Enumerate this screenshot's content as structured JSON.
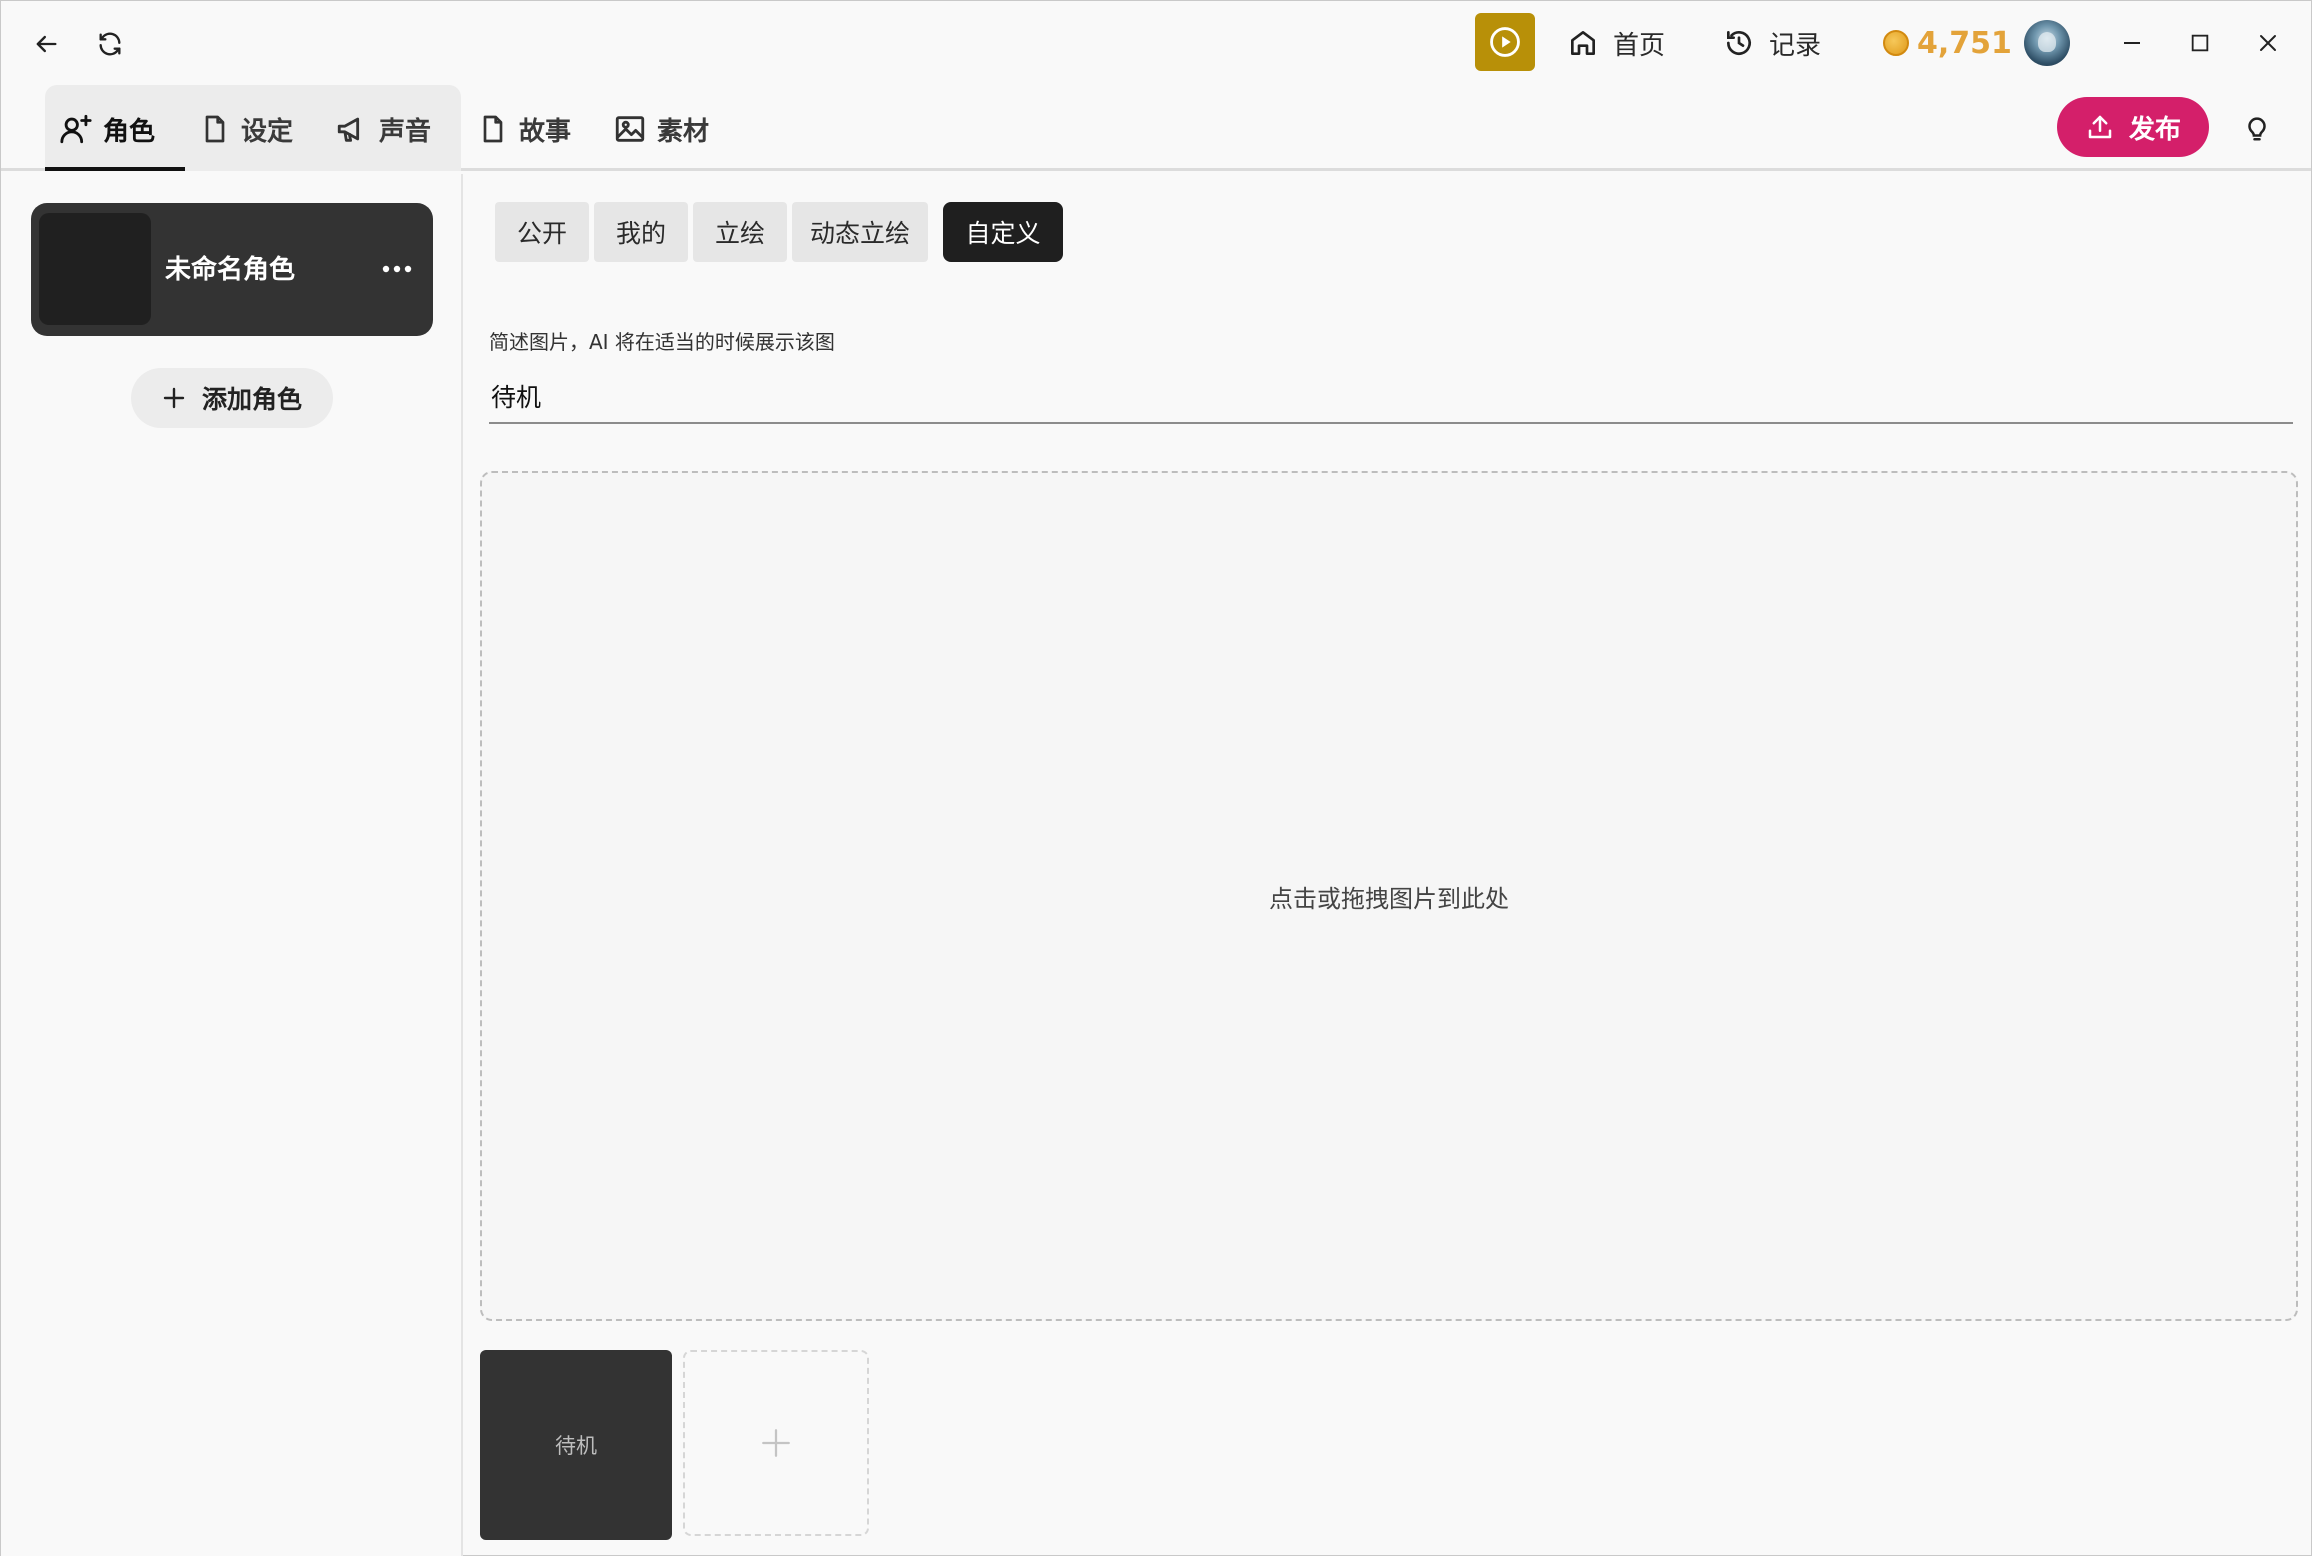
{
  "titlebar": {
    "nav_home_label": "首页",
    "nav_history_label": "记录",
    "coin_balance": "4,751",
    "icons": {
      "back": "arrow-left-icon",
      "reload": "refresh-icon",
      "play": "play-circle-icon",
      "home": "home-icon",
      "history": "history-icon",
      "minimize": "minimize-icon",
      "maximize": "maximize-icon",
      "close": "close-icon"
    },
    "colors": {
      "play_button": "#b89008",
      "coin": "#e3a33a"
    }
  },
  "tabs": {
    "items": [
      {
        "label": "角色",
        "icon": "user-plus-icon",
        "active": true
      },
      {
        "label": "设定",
        "icon": "document-icon",
        "active": false
      },
      {
        "label": "声音",
        "icon": "megaphone-icon",
        "active": false
      },
      {
        "label": "故事",
        "icon": "document-icon",
        "active": false
      },
      {
        "label": "素材",
        "icon": "image-icon",
        "active": false
      }
    ],
    "publish_label": "发布",
    "colors": {
      "publish_button": "#d41f6a"
    }
  },
  "sidebar": {
    "character_name": "未命名角色",
    "add_character_label": "添加角色"
  },
  "main": {
    "segments": [
      {
        "label": "公开",
        "active": false
      },
      {
        "label": "我的",
        "active": false
      },
      {
        "label": "立绘",
        "active": false
      },
      {
        "label": "动态立绘",
        "active": false
      },
      {
        "label": "自定义",
        "active": true
      }
    ],
    "description_label": "简述图片，AI 将在适当的时候展示该图",
    "description_value": "待机",
    "dropzone_text": "点击或拖拽图片到此处",
    "thumbnails": [
      {
        "label": "待机"
      }
    ]
  }
}
